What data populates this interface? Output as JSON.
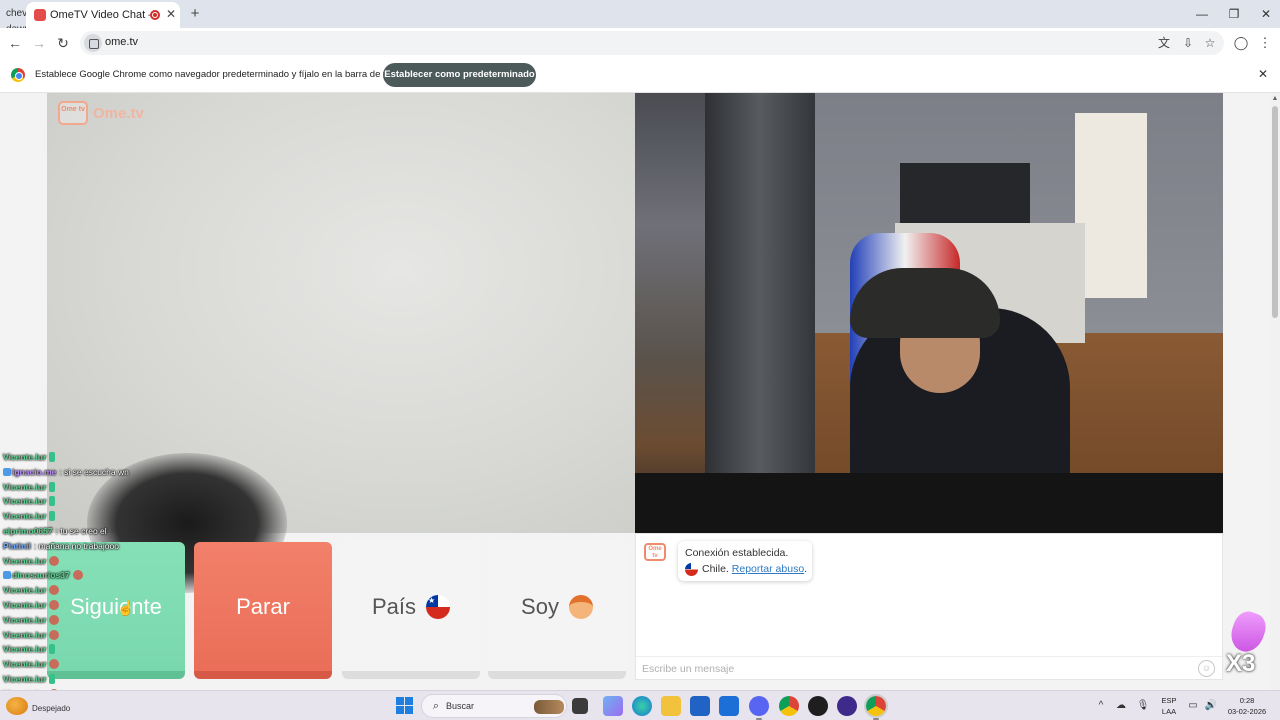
{
  "browser": {
    "tab_title": "OmeTV Video Chat — Ome",
    "url": "ome.tv",
    "infobar_text": "Establece Google Chrome como navegador predeterminado y fíjalo en la barra de tareas",
    "infobar_button": "Establecer como predeterminado",
    "icons": {
      "tab_list": "chevron-down",
      "close": "✕",
      "new_tab": "+",
      "back": "←",
      "forward": "→",
      "reload": "↻",
      "translate": "文",
      "install": "⇩",
      "star": "☆",
      "profile": "◯",
      "menu": "⋮",
      "minimize": "—",
      "restore": "❐",
      "window_close": "✕"
    }
  },
  "page": {
    "logo_badge": "Ome tv",
    "logo_text": "Ome.tv",
    "buttons": {
      "next": "Siguiente",
      "stop": "Parar",
      "country": "País",
      "soy": "Soy"
    },
    "chat": {
      "avatar_text": "Ome tv",
      "message_status": "Conexión establecida.",
      "country": "Chile.",
      "report_link": "Reportar abuso",
      "report_suffix": ".",
      "input_placeholder": "Escribe un mensaje",
      "emoji_icon": "☺"
    }
  },
  "overlay_chat": [
    {
      "user": "Vicente.lur",
      "msg": "",
      "color": "green",
      "emote": "green"
    },
    {
      "user": "Ignacio.me",
      "msg": ": si se escucha wn",
      "color": "purple",
      "badges": true
    },
    {
      "user": "Vicente.lur",
      "msg": "",
      "color": "green",
      "emote": "green"
    },
    {
      "user": "Vicente.lur",
      "msg": "",
      "color": "green",
      "emote": "green"
    },
    {
      "user": "Vicente.lur",
      "msg": "",
      "color": "green",
      "emote": "green"
    },
    {
      "user": "elprimo0657",
      "msg": ": tu se creo el",
      "color": "green"
    },
    {
      "user": "Platinil",
      "msg": ": mañana no trabajooo",
      "color": "blue"
    },
    {
      "user": "Vicente.lur",
      "msg": "",
      "color": "green",
      "emote": "red"
    },
    {
      "user": "dinosaurios37",
      "msg": "",
      "color": "green",
      "badges": true,
      "emote": "red"
    },
    {
      "user": "Vicente.lur",
      "msg": "",
      "color": "green",
      "emote": "red"
    },
    {
      "user": "Vicente.lur",
      "msg": "",
      "color": "green",
      "emote": "red"
    },
    {
      "user": "Vicente.lur",
      "msg": "",
      "color": "green",
      "emote": "red"
    },
    {
      "user": "Vicente.lur",
      "msg": "",
      "color": "green",
      "emote": "red"
    },
    {
      "user": "Vicente.lur",
      "msg": "",
      "color": "green",
      "emote": "green"
    },
    {
      "user": "Vicente.lur",
      "msg": "",
      "color": "green",
      "emote": "red"
    },
    {
      "user": "Vicente.lur",
      "msg": "",
      "color": "green",
      "emote": "green"
    },
    {
      "user": "Vicente.lur",
      "msg": "",
      "color": "green",
      "emote": "red"
    }
  ],
  "overlay_badge": "X3",
  "taskbar": {
    "weather_label": "Despejado",
    "search_label": "Buscar",
    "language_top": "ESP",
    "language_bottom": "LAA",
    "time": "0:28",
    "date": "03-02-2026",
    "icons": {
      "search": "⌕",
      "tray_chevron": "^",
      "network": "☁",
      "mic": "🎙",
      "battery": "▭",
      "volume": "🔊"
    }
  },
  "colors": {
    "next": "#7ad8ae",
    "stop": "#ea6e58",
    "accent": "#ef8b6e",
    "link": "#2f79c4"
  }
}
